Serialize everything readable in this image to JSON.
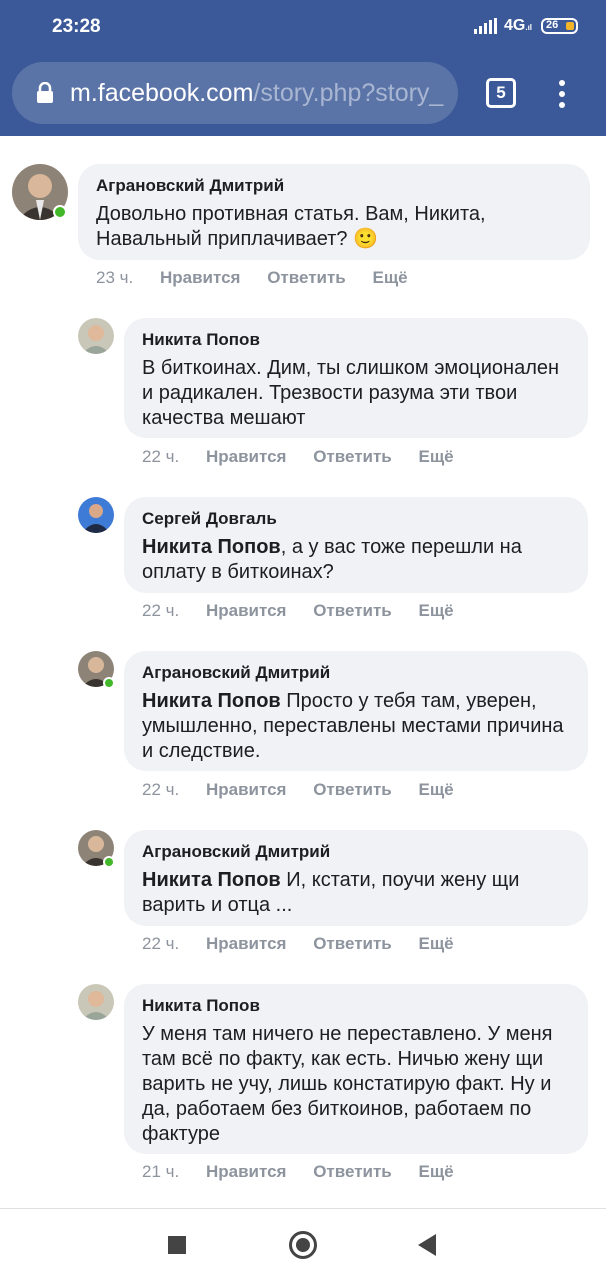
{
  "status": {
    "time": "23:28",
    "network": "4G",
    "battery": "26"
  },
  "browser": {
    "url_host": "m.facebook.com",
    "url_path": "/story.php?story_",
    "tab_count": "5"
  },
  "comments": [
    {
      "author": "Аграновский Дмитрий",
      "mention": "",
      "text": "Довольно противная статья. Вам, Никита, Навальный приплачивает? 🙂",
      "time": "23 ч.",
      "like": "Нравится",
      "reply": "Ответить",
      "more": "Ещё"
    },
    {
      "author": "Никита Попов",
      "mention": "",
      "text": "В биткоинах. Дим, ты слишком эмоционален и радикален. Трезвости разума эти твои качества мешают",
      "time": "22 ч.",
      "like": "Нравится",
      "reply": "Ответить",
      "more": "Ещё"
    },
    {
      "author": "Сергей Довгаль",
      "mention": "Никита Попов",
      "text": ", а у вас тоже перешли на оплату в биткоинах?",
      "time": "22 ч.",
      "like": "Нравится",
      "reply": "Ответить",
      "more": "Ещё"
    },
    {
      "author": "Аграновский Дмитрий",
      "mention": "Никита Попов",
      "text": " Просто у тебя там, уверен, умышленно, переставлены местами причина и следствие.",
      "time": "22 ч.",
      "like": "Нравится",
      "reply": "Ответить",
      "more": "Ещё"
    },
    {
      "author": "Аграновский Дмитрий",
      "mention": "Никита Попов",
      "text": " И, кстати, поучи жену щи варить и отца ...",
      "time": "22 ч.",
      "like": "Нравится",
      "reply": "Ответить",
      "more": "Ещё"
    },
    {
      "author": "Никита Попов",
      "mention": "",
      "text": "У меня там ничего не переставлено. У меня там всё по факту, как есть. Ничью жену щи варить не учу, лишь констатирую факт. Ну и да, работаем без биткоинов, работаем по фактуре",
      "time": "21 ч.",
      "like": "Нравится",
      "reply": "Ответить",
      "more": "Ещё"
    }
  ]
}
